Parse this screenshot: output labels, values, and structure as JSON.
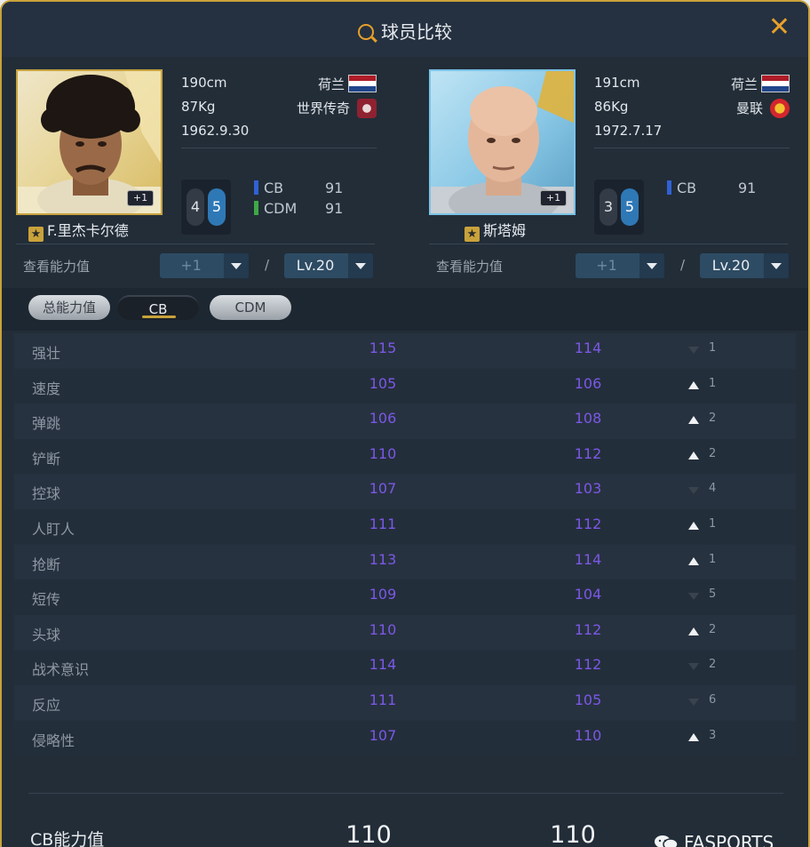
{
  "window": {
    "title": "球员比较"
  },
  "players": [
    {
      "name": "F.里杰卡尔德",
      "height": "190cm",
      "weight": "87Kg",
      "birth": "1962.9.30",
      "nation": "荷兰",
      "team": "世界传奇",
      "badge": "+1",
      "skill_left": "4",
      "skill_right": "5",
      "positions": [
        {
          "code": "CB",
          "value": "91",
          "color": "#2f62d4"
        },
        {
          "code": "CDM",
          "value": "91",
          "color": "#3fa846"
        }
      ],
      "view_label": "查看能力值",
      "enhance": "+1",
      "level": "Lv.20",
      "slash": "/"
    },
    {
      "name": "斯塔姆",
      "height": "191cm",
      "weight": "86Kg",
      "birth": "1972.7.17",
      "nation": "荷兰",
      "team": "曼联",
      "badge": "+1",
      "skill_left": "3",
      "skill_right": "5",
      "positions": [
        {
          "code": "CB",
          "value": "91",
          "color": "#2f62d4"
        }
      ],
      "view_label": "查看能力值",
      "enhance": "+1",
      "level": "Lv.20",
      "slash": "/"
    }
  ],
  "tabs": [
    {
      "label": "总能力值"
    },
    {
      "label": "CB",
      "active": true
    },
    {
      "label": "CDM"
    }
  ],
  "stats": [
    {
      "label": "强壮",
      "a": "115",
      "b": "114",
      "dir": "down",
      "diff": "1"
    },
    {
      "label": "速度",
      "a": "105",
      "b": "106",
      "dir": "up",
      "diff": "1"
    },
    {
      "label": "弹跳",
      "a": "106",
      "b": "108",
      "dir": "up",
      "diff": "2"
    },
    {
      "label": "铲断",
      "a": "110",
      "b": "112",
      "dir": "up",
      "diff": "2"
    },
    {
      "label": "控球",
      "a": "107",
      "b": "103",
      "dir": "down",
      "diff": "4"
    },
    {
      "label": "人盯人",
      "a": "111",
      "b": "112",
      "dir": "up",
      "diff": "1"
    },
    {
      "label": "抢断",
      "a": "113",
      "b": "114",
      "dir": "up",
      "diff": "1"
    },
    {
      "label": "短传",
      "a": "109",
      "b": "104",
      "dir": "down",
      "diff": "5"
    },
    {
      "label": "头球",
      "a": "110",
      "b": "112",
      "dir": "up",
      "diff": "2"
    },
    {
      "label": "战术意识",
      "a": "114",
      "b": "112",
      "dir": "down",
      "diff": "2"
    },
    {
      "label": "反应",
      "a": "111",
      "b": "105",
      "dir": "down",
      "diff": "6"
    },
    {
      "label": "侵略性",
      "a": "107",
      "b": "110",
      "dir": "up",
      "diff": "3"
    }
  ],
  "summary": {
    "label": "CB能力值",
    "a": "110",
    "b": "110"
  },
  "watermark": "FASPORTS",
  "colors": {
    "accent": "#c9a23a",
    "stat_value": "#7b58e6",
    "flag_nl": [
      "#ae1c28",
      "#ffffff",
      "#21468b"
    ]
  }
}
